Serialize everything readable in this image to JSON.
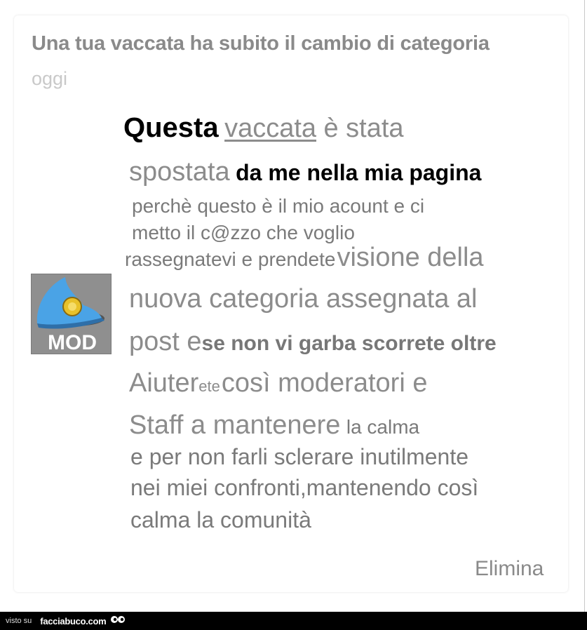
{
  "notification": {
    "title": "Una tua vaccata ha subito il cambio di categoria",
    "date_fragment": "oggi"
  },
  "mod_icon": {
    "label": "MOD",
    "icon": "police-cap-icon"
  },
  "message": {
    "l1_a": "Questa",
    "l1_link": "vaccata",
    "l1_b": "è stata",
    "l2_a": "spostata",
    "l2_b": "da me nella mia pagina",
    "l3": "perchè questo è il mio acount e ci",
    "l4": "metto il c@zzo che voglio",
    "l5_a": "rassegnatevi e prendete",
    "l5_b": "visione della",
    "l6": "nuova categoria assegnata al",
    "l7_a": "post e",
    "l7_b": "se non vi garba scorrete oltre",
    "l8_a": "Aiuter",
    "l8_b": "ete",
    "l8_c": "così moderatori e",
    "l9_a": "Staff a mantenere",
    "l9_b": "la calma",
    "l10": "e per non farli sclerare inutilmente",
    "l11": "nei miei confronti,mantenendo così",
    "l12": "calma la comunità"
  },
  "actions": {
    "delete_label": "Elimina"
  },
  "footer": {
    "visto": "visto su",
    "brand": "facciabuco.com"
  }
}
